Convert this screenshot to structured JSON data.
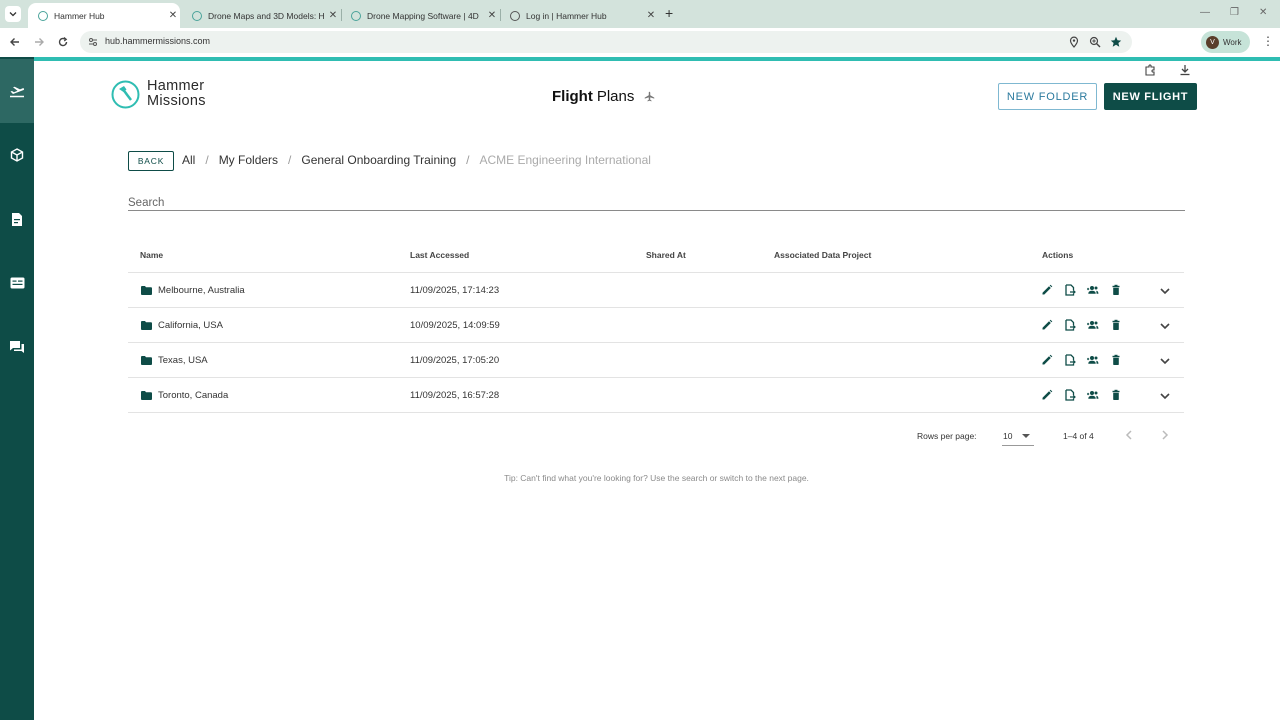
{
  "browser": {
    "tabs": [
      {
        "title": "Hammer Hub",
        "active": true
      },
      {
        "title": "Drone Maps and 3D Models: H",
        "active": false
      },
      {
        "title": "Drone Mapping Software | 4D",
        "active": false
      },
      {
        "title": "Log in | Hammer Hub",
        "active": false
      }
    ],
    "url": "hub.hammermissions.com",
    "profile_initial": "V",
    "profile_label": "Work"
  },
  "rail": {
    "items": [
      "flight-plans",
      "models",
      "reports",
      "data",
      "messages"
    ],
    "active": "flight-plans"
  },
  "header": {
    "logo_line1": "Hammer",
    "logo_line2": "Missions",
    "title_bold": "Flight",
    "title_rest": "Plans",
    "new_folder_label": "NEW FOLDER",
    "new_flight_label": "NEW FLIGHT"
  },
  "breadcrumb": {
    "back_label": "BACK",
    "items": [
      "All",
      "My Folders",
      "General Onboarding Training",
      "ACME Engineering International"
    ]
  },
  "search": {
    "placeholder": "Search"
  },
  "table": {
    "columns": {
      "name": "Name",
      "last_accessed": "Last Accessed",
      "shared_at": "Shared At",
      "project": "Associated Data Project",
      "actions": "Actions"
    },
    "rows": [
      {
        "name": "Melbourne, Australia",
        "last_accessed": "11/09/2025, 17:14:23",
        "shared_at": "",
        "project": ""
      },
      {
        "name": "California, USA",
        "last_accessed": "10/09/2025, 14:09:59",
        "shared_at": "",
        "project": ""
      },
      {
        "name": "Texas, USA",
        "last_accessed": "11/09/2025, 17:05:20",
        "shared_at": "",
        "project": ""
      },
      {
        "name": "Toronto, Canada",
        "last_accessed": "11/09/2025, 16:57:28",
        "shared_at": "",
        "project": ""
      }
    ]
  },
  "pagination": {
    "rows_per_page_label": "Rows per page:",
    "rows_per_page": "10",
    "range": "1–4 of 4"
  },
  "tip": "Tip: Can't find what you're looking for? Use the search or switch to the next page.",
  "colors": {
    "brand_dark": "#0e4c47",
    "accent": "#2fbdb2",
    "outline_blue": "#2b7a9e"
  }
}
